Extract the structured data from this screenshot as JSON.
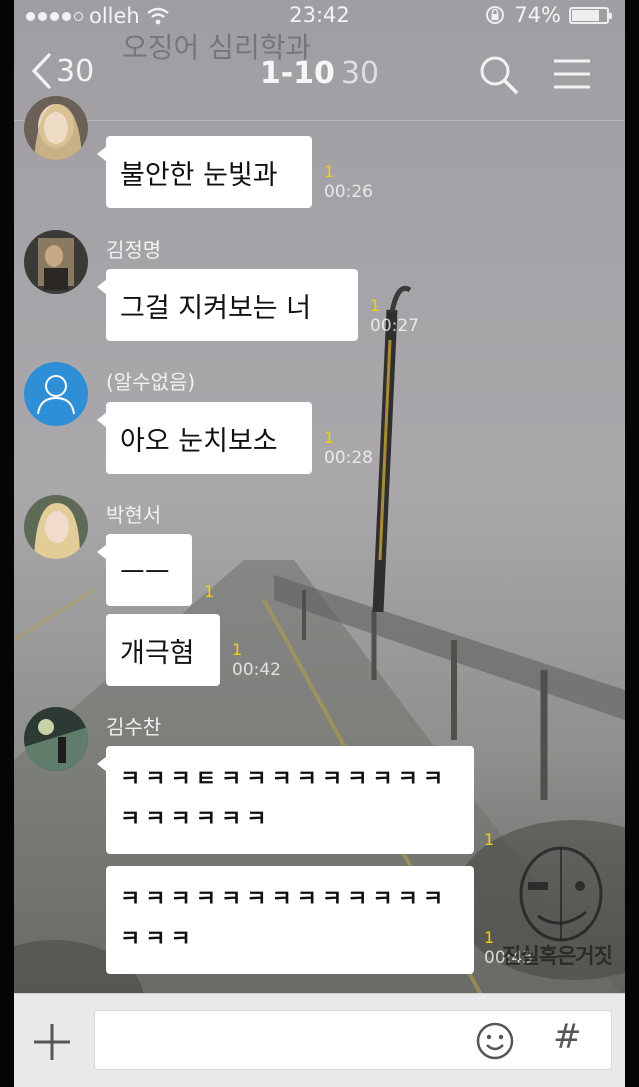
{
  "status_bar": {
    "carrier": "olleh",
    "time": "23:42",
    "battery": "74%",
    "battery_level": 0.74
  },
  "header": {
    "ghost_title": "오징어 심리학과",
    "back_count": "30",
    "title": "1-10",
    "member_count": "30",
    "icons": [
      "search-icon",
      "menu-icon"
    ]
  },
  "messages": [
    {
      "sender": "",
      "text": "불안한 눈빛과",
      "unread": "1",
      "time": "00:26"
    },
    {
      "sender": "김정명",
      "text": "그걸 지켜보는  너",
      "unread": "1",
      "time": "00:27"
    },
    {
      "sender": "(알수없음)",
      "text": "아오 눈치보소",
      "unread": "1",
      "time": "00:28"
    },
    {
      "sender": "박현서",
      "text": "ㅡㅡ",
      "unread": "1",
      "time": ""
    },
    {
      "sender": "",
      "text": "개극혐",
      "unread": "1",
      "time": "00:42"
    },
    {
      "sender": "김수찬",
      "text": "ㅋㅋㅋㅌㅋㅋㅋㅋㅋㅋㅋㅋㅋㅋㅋㅋㅋㅋㅋ",
      "unread": "1",
      "time": ""
    },
    {
      "sender": "",
      "text": "ㅋㅋㅋㅋㅋㅋㅋㅋㅋㅋㅋㅋㅋㅋㅋㅋ",
      "unread": "1",
      "time": "00:43"
    }
  ],
  "input_bar": {
    "hash_label": "#",
    "icons": [
      "plus-icon",
      "emoji-icon",
      "hash-icon"
    ]
  },
  "watermark": {
    "text": "진실혹은거짓"
  },
  "colors": {
    "unread": "#f0d000",
    "bubble": "#ffffff",
    "input_bar": "#e9e9ec"
  }
}
